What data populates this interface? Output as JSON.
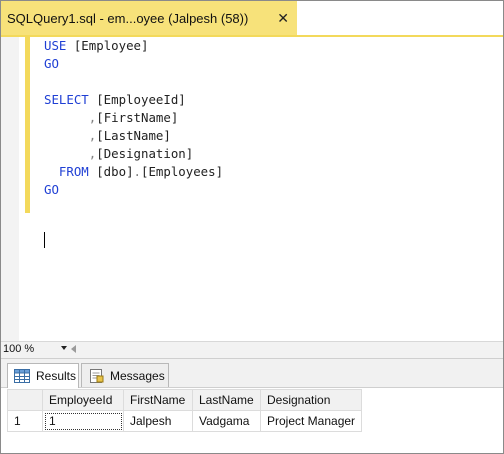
{
  "window": {
    "tab_title": "SQLQuery1.sql - em...oyee (Jalpesh (58))",
    "close_glyph": "✕"
  },
  "editor": {
    "lines": [
      [
        {
          "t": "USE",
          "c": "kw"
        },
        {
          "t": " [Employee]",
          "c": "br"
        }
      ],
      [
        {
          "t": "GO",
          "c": "kw"
        }
      ],
      [],
      [
        {
          "t": "SELECT",
          "c": "kw"
        },
        {
          "t": " [EmployeeId]",
          "c": "br"
        }
      ],
      [
        {
          "t": "      ",
          "c": "br"
        },
        {
          "t": ",",
          "c": "gr"
        },
        {
          "t": "[FirstName]",
          "c": "br"
        }
      ],
      [
        {
          "t": "      ",
          "c": "br"
        },
        {
          "t": ",",
          "c": "gr"
        },
        {
          "t": "[LastName]",
          "c": "br"
        }
      ],
      [
        {
          "t": "      ",
          "c": "br"
        },
        {
          "t": ",",
          "c": "gr"
        },
        {
          "t": "[Designation]",
          "c": "br"
        }
      ],
      [
        {
          "t": "  ",
          "c": "br"
        },
        {
          "t": "FROM",
          "c": "kw"
        },
        {
          "t": " [dbo]",
          "c": "br"
        },
        {
          "t": ".",
          "c": "gr"
        },
        {
          "t": "[Employees]",
          "c": "br"
        }
      ],
      [
        {
          "t": "GO",
          "c": "kw"
        }
      ]
    ]
  },
  "status": {
    "zoom": "100 %"
  },
  "results": {
    "tabs": [
      {
        "label": "Results",
        "icon": "grid-icon",
        "active": true
      },
      {
        "label": "Messages",
        "icon": "messages-icon",
        "active": false
      }
    ],
    "columns": [
      "",
      "EmployeeId",
      "FirstName",
      "LastName",
      "Designation"
    ],
    "rows": [
      [
        "1",
        "1",
        "Jalpesh",
        "Vadgama",
        "Project Manager"
      ]
    ]
  },
  "colors": {
    "tab_yellow": "#f7e27a",
    "keyword_blue": "#1f3fd4",
    "change_bar": "#f3d95b"
  }
}
